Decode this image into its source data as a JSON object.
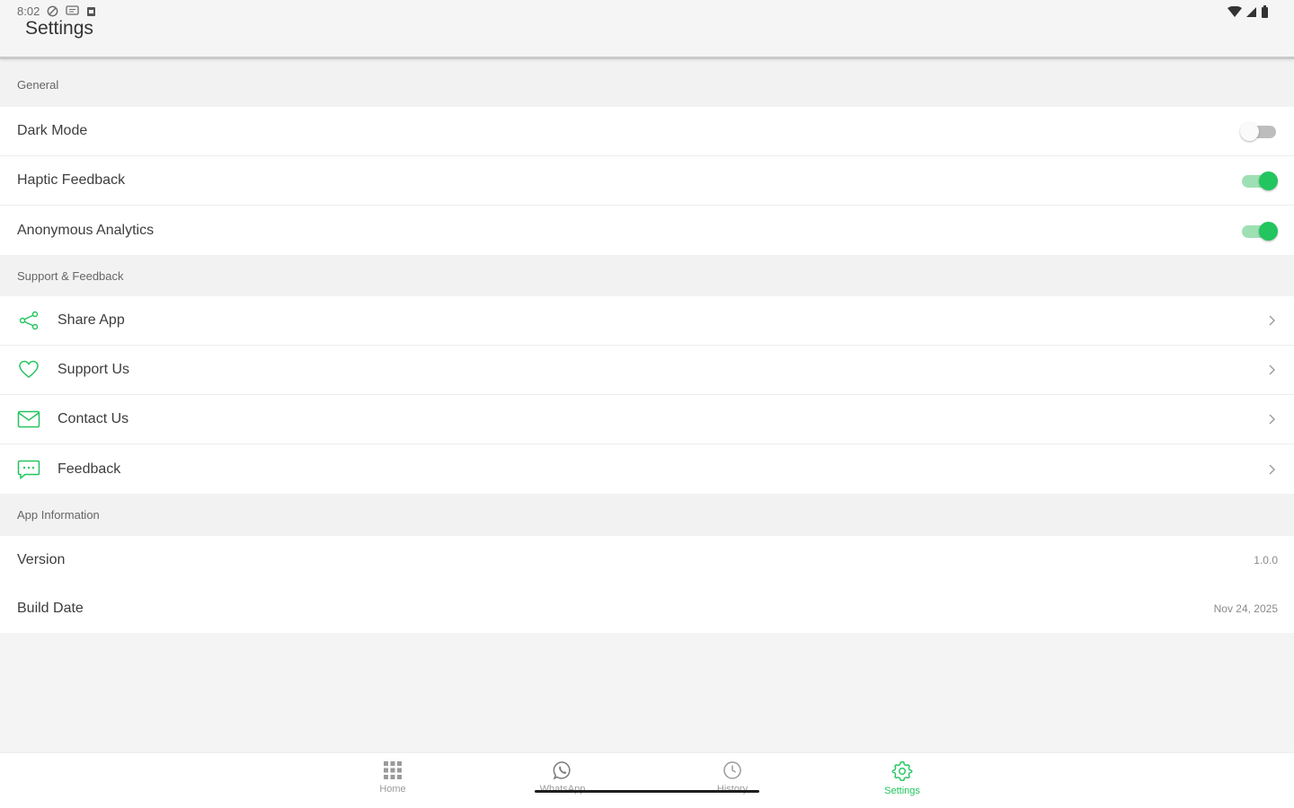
{
  "status_bar": {
    "time": "8:02"
  },
  "header": {
    "title": "Settings"
  },
  "sections": {
    "general": {
      "title": "General",
      "items": [
        {
          "label": "Dark Mode",
          "on": false
        },
        {
          "label": "Haptic Feedback",
          "on": true
        },
        {
          "label": "Anonymous Analytics",
          "on": true
        }
      ]
    },
    "support": {
      "title": "Support & Feedback",
      "items": [
        {
          "label": "Share App",
          "icon": "share-icon"
        },
        {
          "label": "Support Us",
          "icon": "heart-icon"
        },
        {
          "label": "Contact Us",
          "icon": "mail-icon"
        },
        {
          "label": "Feedback",
          "icon": "chat-icon"
        }
      ]
    },
    "app_info": {
      "title": "App Information",
      "items": [
        {
          "label": "Version",
          "value": "1.0.0"
        },
        {
          "label": "Build Date",
          "value": "Nov 24, 2025"
        }
      ]
    }
  },
  "bottom_nav": {
    "items": [
      {
        "label": "Home",
        "icon": "grid-icon"
      },
      {
        "label": "WhatsApp",
        "icon": "whatsapp-icon"
      },
      {
        "label": "History",
        "icon": "clock-icon"
      },
      {
        "label": "Settings",
        "icon": "gear-icon",
        "active": true
      }
    ]
  },
  "colors": {
    "accent": "#22c55e",
    "accent_track": "#9ee0b4",
    "off_track": "#bdbdbd"
  }
}
